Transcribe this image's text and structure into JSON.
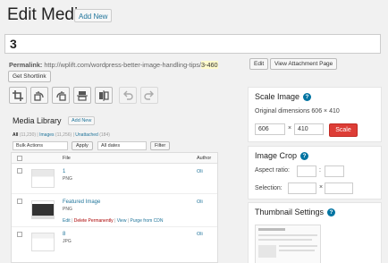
{
  "header": {
    "title": "Edit Media",
    "add_new": "Add New"
  },
  "title_field": {
    "value": "3"
  },
  "permalink": {
    "label": "Permalink:",
    "url": "http://wplift.com/wordpress-better-image-handling-tips/",
    "slug": "3-460",
    "edit": "Edit",
    "view": "View Attachment Page",
    "shortlink": "Get Shortlink"
  },
  "toolbar": {
    "icons": [
      "crop-icon",
      "rotate-left-icon",
      "rotate-right-icon",
      "flip-vertical-icon",
      "flip-horizontal-icon",
      "undo-icon",
      "redo-icon"
    ]
  },
  "media_library": {
    "title": "Media Library",
    "add_new": "Add New",
    "filters": {
      "all": "All",
      "all_count": "(11,230)",
      "images": "Images",
      "images_count": "(11,256)",
      "unattached": "Unattached",
      "unattached_count": "(184)"
    },
    "bulk_actions": "Bulk Actions",
    "apply": "Apply",
    "all_dates": "All dates",
    "filter": "Filter",
    "columns": {
      "file": "File",
      "author": "Author"
    },
    "rows": [
      {
        "name": "1",
        "type": "PNG",
        "author": "Oli"
      },
      {
        "name": "Featured Image",
        "type": "PNG",
        "author": "Oli",
        "actions": {
          "edit": "Edit",
          "delete": "Delete Permanently",
          "view": "View",
          "purge": "Purge from CDN"
        }
      },
      {
        "name": "8",
        "type": "JPG",
        "author": "Oli"
      }
    ]
  },
  "scale_image": {
    "title": "Scale Image",
    "original": "Original dimensions 606 × 410",
    "width": "606",
    "height": "410",
    "times": "×",
    "button": "Scale",
    "button_color": "#dd3d36"
  },
  "image_crop": {
    "title": "Image Crop",
    "aspect_label": "Aspect ratio:",
    "colon": ":",
    "selection_label": "Selection:",
    "times": "×"
  },
  "thumbnail_settings": {
    "title": "Thumbnail Settings"
  },
  "accent_color": "#21759b",
  "help_color": "#0074a2"
}
